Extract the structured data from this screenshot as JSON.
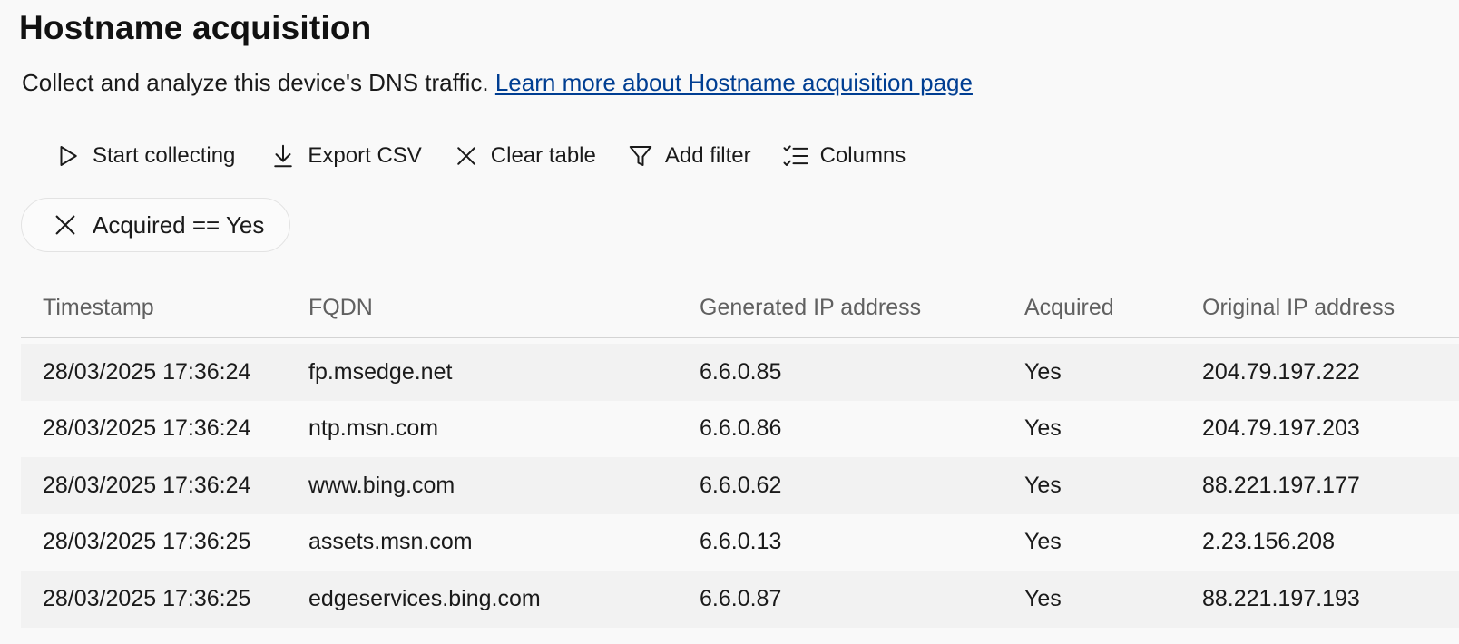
{
  "page": {
    "title": "Hostname acquisition",
    "description": "Collect and analyze this device's DNS traffic.",
    "learn_more_link": "Learn more about Hostname acquisition page"
  },
  "toolbar": {
    "start_collecting": {
      "label": "Start collecting",
      "icon": "play-icon"
    },
    "export_csv": {
      "label": "Export CSV",
      "icon": "download-icon"
    },
    "clear_table": {
      "label": "Clear table",
      "icon": "close-icon"
    },
    "add_filter": {
      "label": "Add filter",
      "icon": "filter-icon"
    },
    "columns": {
      "label": "Columns",
      "icon": "checklist-icon"
    }
  },
  "active_filters": [
    {
      "label": "Acquired == Yes",
      "icon": "close-icon"
    }
  ],
  "table": {
    "columns": [
      "Timestamp",
      "FQDN",
      "Generated IP address",
      "Acquired",
      "Original IP address"
    ],
    "rows": [
      [
        "28/03/2025 17:36:24",
        "fp.msedge.net",
        "6.6.0.85",
        "Yes",
        "204.79.197.222"
      ],
      [
        "28/03/2025 17:36:24",
        "ntp.msn.com",
        "6.6.0.86",
        "Yes",
        "204.79.197.203"
      ],
      [
        "28/03/2025 17:36:24",
        "www.bing.com",
        "6.6.0.62",
        "Yes",
        "88.221.197.177"
      ],
      [
        "28/03/2025 17:36:25",
        "assets.msn.com",
        "6.6.0.13",
        "Yes",
        "2.23.156.208"
      ],
      [
        "28/03/2025 17:36:25",
        "edgeservices.bing.com",
        "6.6.0.87",
        "Yes",
        "88.221.197.193"
      ]
    ]
  },
  "colors": {
    "link": "#003e92",
    "background": "#f9f9f9",
    "row_alt": "#f2f2f2",
    "header_text": "#606060"
  }
}
